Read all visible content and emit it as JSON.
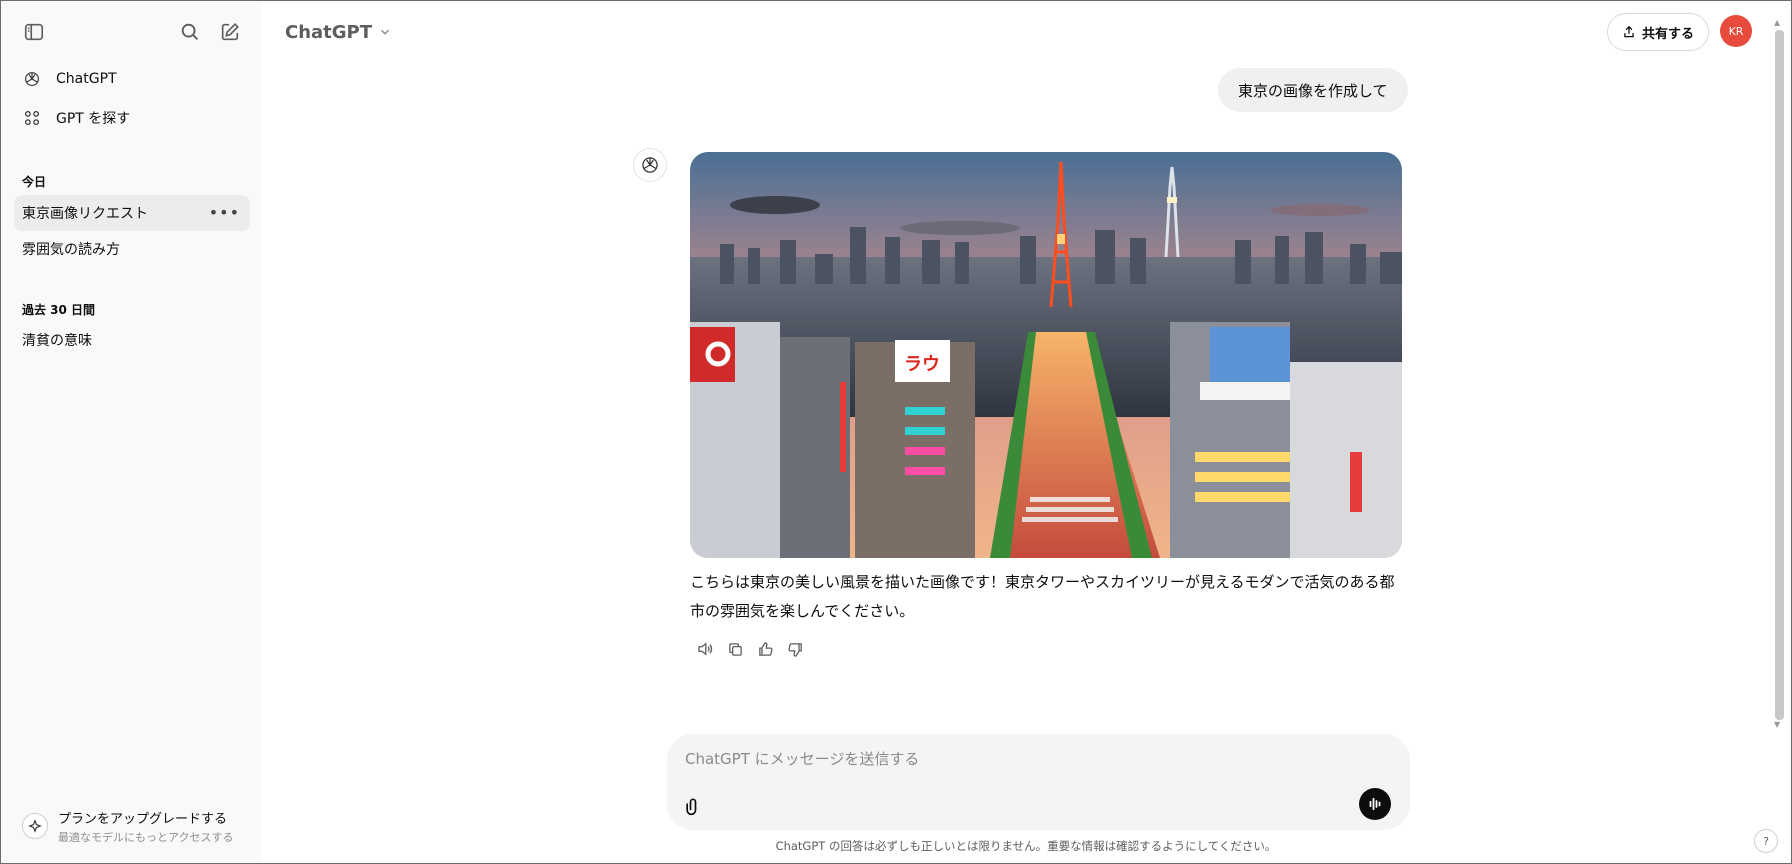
{
  "sidebar": {
    "nav": [
      {
        "label": "ChatGPT",
        "icon": "openai-logo-icon"
      },
      {
        "label": "GPT を探す",
        "icon": "grid-icon"
      }
    ],
    "sections": [
      {
        "title": "今日",
        "chats": [
          "東京画像リクエスト",
          "雰囲気の読み方"
        ]
      },
      {
        "title": "過去 30 日間",
        "chats": [
          "清貧の意味"
        ]
      }
    ],
    "more_glyph": "•••",
    "upgrade": {
      "title": "プランをアップグレードする",
      "subtitle": "最適なモデルにもっとアクセスする"
    }
  },
  "header": {
    "model_label": "ChatGPT",
    "share_label": "共有する",
    "avatar_initials": "KR"
  },
  "conversation": {
    "user_message": "東京の画像を作成して",
    "assistant_text": "こちらは東京の美しい風景を描いた画像です！東京タワーやスカイツリーが見えるモダンで活気のある都市の雰囲気を楽しんでください。",
    "image_sign_text": "ラウ",
    "actions": [
      "read-aloud-icon",
      "copy-icon",
      "thumbs-up-icon",
      "thumbs-down-icon"
    ]
  },
  "composer": {
    "placeholder": "ChatGPT にメッセージを送信する",
    "value": ""
  },
  "footer": {
    "disclaimer": "ChatGPT の回答は必ずしも正しいとは限りません。重要な情報は確認するようにしてください。",
    "help": "?"
  },
  "colors": {
    "sidebar_bg": "#f9f9f9",
    "active_chat": "#ececec",
    "bubble_bg": "#f0f0f0",
    "composer_bg": "#f4f4f4",
    "avatar_bg": "#e84a3c",
    "tower_red": "#e8391f"
  }
}
